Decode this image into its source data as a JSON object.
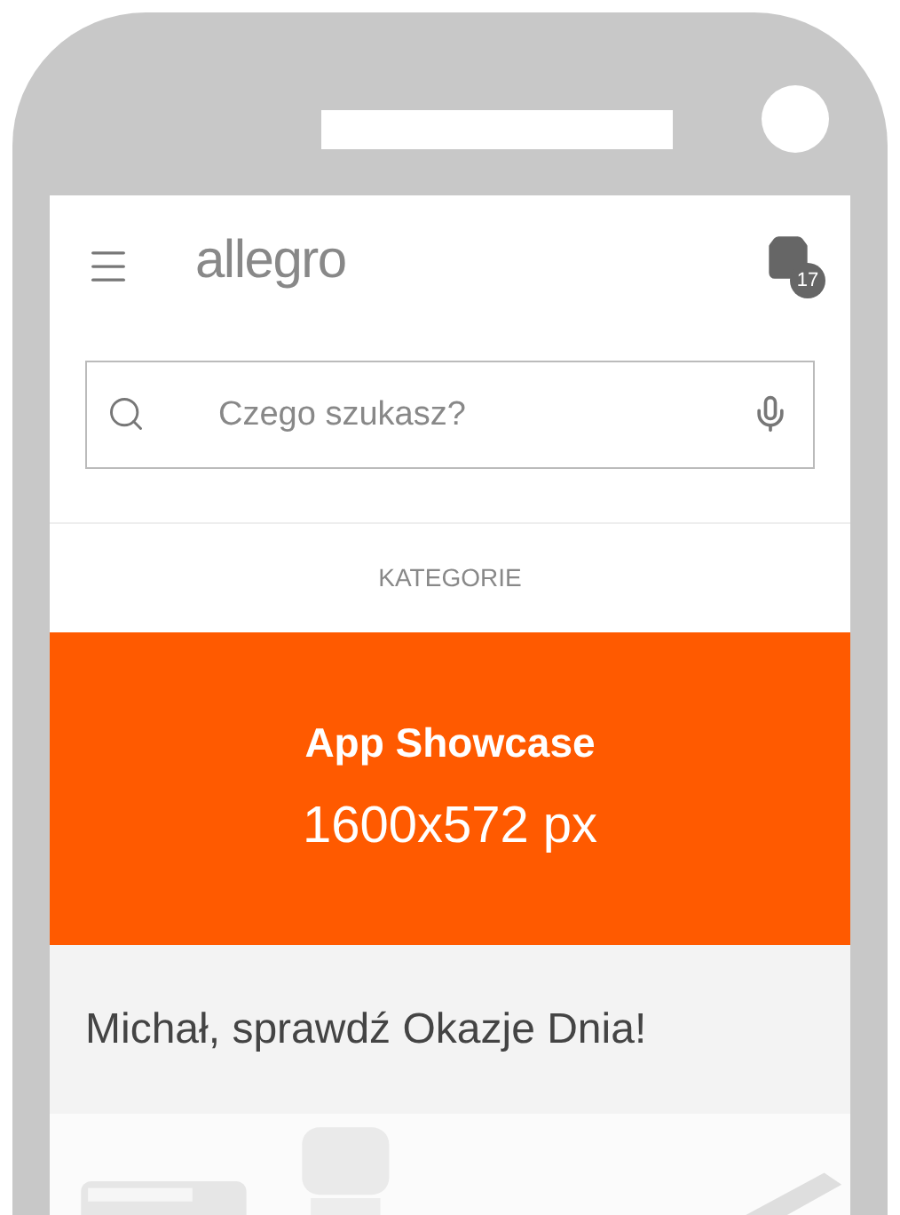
{
  "header": {
    "logo": "allegro",
    "cart_count": "17"
  },
  "search": {
    "placeholder": "Czego szukasz?"
  },
  "categories_link": "KATEGORIE",
  "banner": {
    "title": "App Showcase",
    "subtitle": "1600x572 px"
  },
  "greeting": "Michał, sprawdź Okazje Dnia!"
}
